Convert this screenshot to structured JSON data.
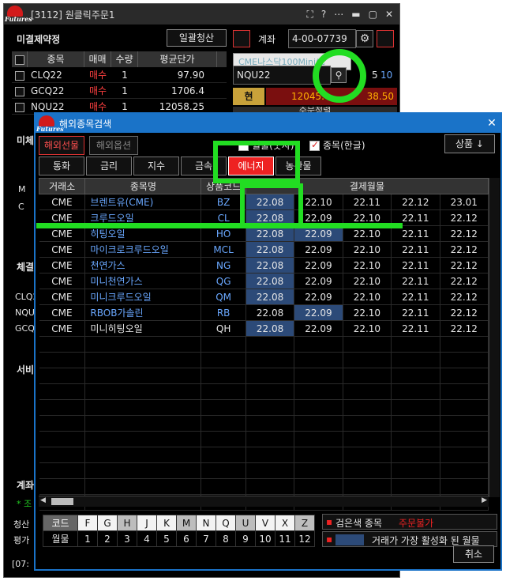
{
  "main_window": {
    "title": "[3112] 원클릭주문1",
    "title_buttons": [
      "⛶",
      "?",
      "⋯",
      "▬",
      "▢",
      "✕"
    ],
    "unsettled_label": "미결제약정",
    "bulk_clear_button": "일괄청산",
    "account_label": "계좌",
    "account_number": "4-00-07739",
    "columns": [
      "종목",
      "매매",
      "수량",
      "평균단가"
    ],
    "rows": [
      {
        "symbol": "CLQ22",
        "side": "매수",
        "qty": "1",
        "price": "97.90"
      },
      {
        "symbol": "GCQ22",
        "side": "매수",
        "qty": "1",
        "price": "1706.4"
      },
      {
        "symbol": "NQU22",
        "side": "매수",
        "qty": "1",
        "price": "12058.25"
      }
    ],
    "product_name": "CME나스닥100Mini(C",
    "symbol_input": "NQU22",
    "qty_value": "5",
    "qty_value2": "10",
    "current_label": "현",
    "current_price": "12045.",
    "price_change": "38.50",
    "sub_header": "주문정렬",
    "side_labels": [
      "미체",
      "체결",
      "서비",
      "계좌"
    ],
    "partial_symbols": [
      "CLQ2",
      "NQU2",
      "GCQ2"
    ],
    "side_letters": [
      "M",
      "C"
    ],
    "status_time": "[07:",
    "side_cash": "청산",
    "side_eval": "평가",
    "side_star": "* 조"
  },
  "dialog": {
    "title": "해외종목검색",
    "market_tabs": [
      "해외선물",
      "해외옵션"
    ],
    "monthly_number": "월물(숫자)",
    "symbol_korean": "종목(한글)",
    "product_button": "상품 ↓",
    "categories": [
      "통화",
      "금리",
      "지수",
      "금속",
      "에너지",
      "농산물"
    ],
    "active_category": "에너지",
    "headers": [
      "거래소",
      "종목명",
      "상품코드",
      "결제월물"
    ],
    "rows": [
      {
        "ex": "CME",
        "name": "브렌트유(CME)",
        "code": "BZ",
        "months": [
          "22.08",
          "22.10",
          "22.11",
          "22.12",
          "23.01"
        ],
        "hl": [
          0
        ],
        "white": false
      },
      {
        "ex": "CME",
        "name": "크루드오일",
        "code": "CL",
        "months": [
          "22.08",
          "22.09",
          "22.10",
          "22.11",
          "22.12"
        ],
        "hl": [
          0
        ],
        "white": false
      },
      {
        "ex": "CME",
        "name": "히팅오일",
        "code": "HO",
        "months": [
          "22.08",
          "22.09",
          "22.10",
          "22.11",
          "22.12"
        ],
        "hl": [
          0,
          1
        ],
        "white": false
      },
      {
        "ex": "CME",
        "name": "마이크로크루드오일",
        "code": "MCL",
        "months": [
          "22.08",
          "22.09",
          "22.10",
          "22.11",
          "22.12"
        ],
        "hl": [
          0
        ],
        "white": false
      },
      {
        "ex": "CME",
        "name": "천연가스",
        "code": "NG",
        "months": [
          "22.08",
          "22.09",
          "22.10",
          "22.11",
          "22.12"
        ],
        "hl": [
          0
        ],
        "white": false
      },
      {
        "ex": "CME",
        "name": "미니천연가스",
        "code": "QG",
        "months": [
          "22.08",
          "22.09",
          "22.10",
          "22.11",
          "22.12"
        ],
        "hl": [
          0
        ],
        "white": false
      },
      {
        "ex": "CME",
        "name": "미니크루드오일",
        "code": "QM",
        "months": [
          "22.08",
          "22.09",
          "22.10",
          "22.11",
          "22.12"
        ],
        "hl": [
          0
        ],
        "white": false
      },
      {
        "ex": "CME",
        "name": "RBOB가솔린",
        "code": "RB",
        "months": [
          "22.08",
          "22.09",
          "22.10",
          "22.11",
          "22.12"
        ],
        "hl": [
          1
        ],
        "white": false
      },
      {
        "ex": "CME",
        "name": "미니히팅오일",
        "code": "QH",
        "months": [
          "22.08",
          "22.09",
          "22.10",
          "22.11",
          "22.12"
        ],
        "hl": [
          0
        ],
        "white": true
      }
    ],
    "month_codes_label": "코드",
    "month_codes": [
      "F",
      "G",
      "H",
      "J",
      "K",
      "M",
      "N",
      "Q",
      "U",
      "V",
      "X",
      "Z"
    ],
    "month_label": "월물",
    "month_numbers": [
      "1",
      "2",
      "3",
      "4",
      "5",
      "6",
      "7",
      "8",
      "9",
      "10",
      "11",
      "12"
    ],
    "legend_1": "검은색 종목",
    "legend_1_red": "주문불가",
    "legend_2": "거래가 가장 활성화 된 월물",
    "cancel_button": "취소"
  },
  "colors": {
    "accent": "#1a73c8",
    "highlight": "#2c4a78",
    "annotation": "#22dd22",
    "sell_buy": "#ff4040"
  }
}
